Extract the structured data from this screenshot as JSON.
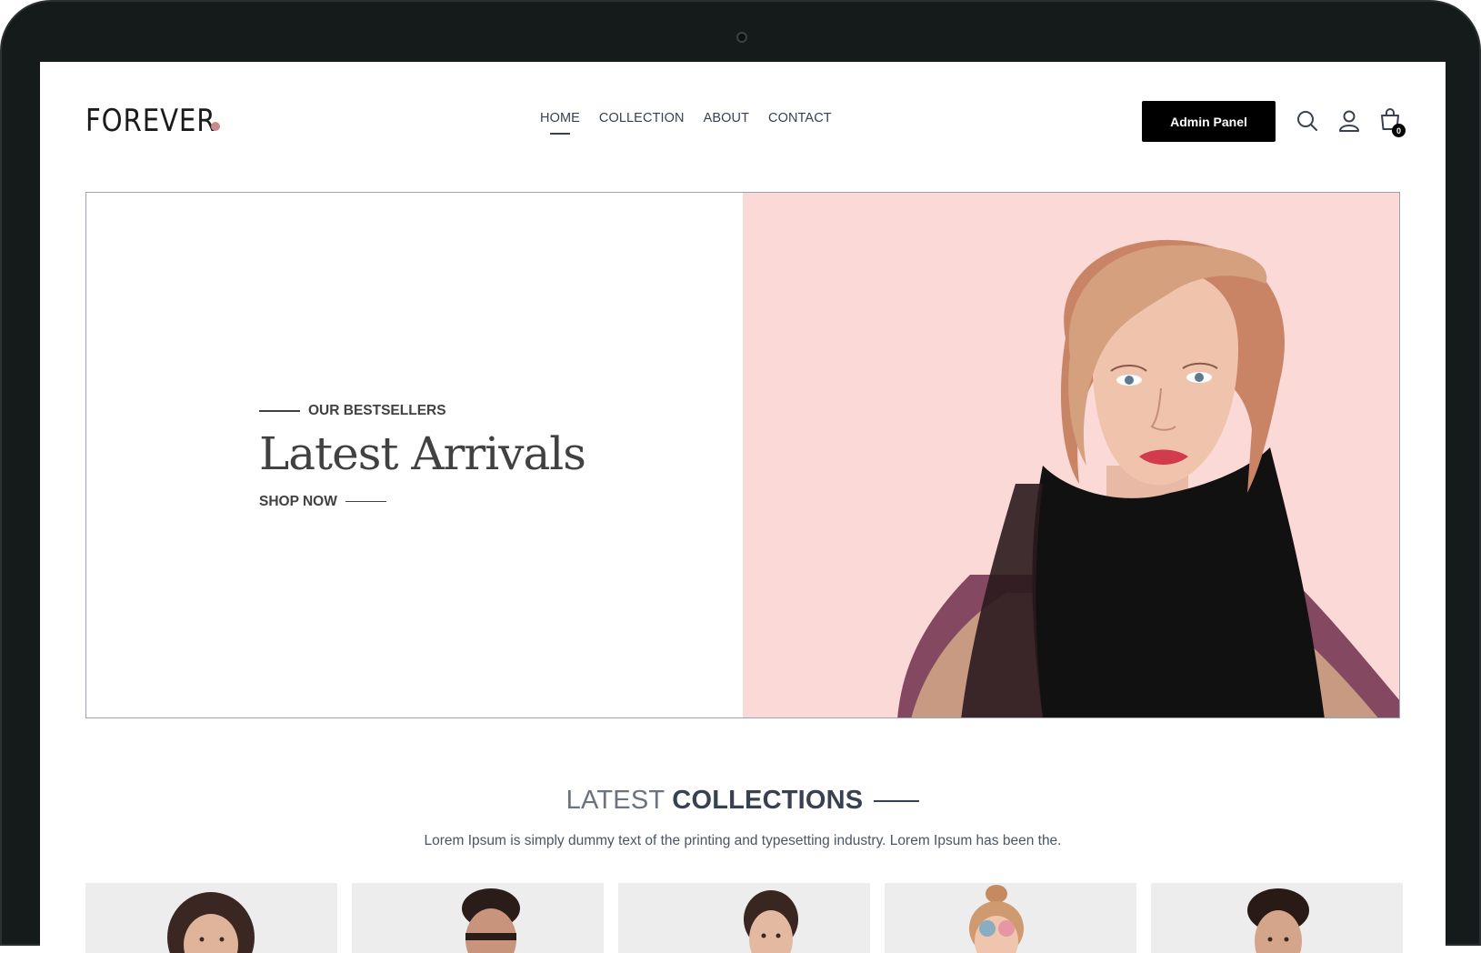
{
  "brand": {
    "name": "FOREVER",
    "dot_color": "#c58d8a"
  },
  "nav": {
    "items": [
      {
        "label": "HOME",
        "active": true
      },
      {
        "label": "COLLECTION",
        "active": false
      },
      {
        "label": "ABOUT",
        "active": false
      },
      {
        "label": "CONTACT",
        "active": false
      }
    ]
  },
  "header": {
    "admin_label": "Admin Panel",
    "cart_count": "0",
    "icons": [
      "search-icon",
      "profile-icon",
      "cart-icon"
    ]
  },
  "hero": {
    "kicker": "OUR BESTSELLERS",
    "title": "Latest Arrivals",
    "cta": "SHOP NOW",
    "bg_color": "#fad9d6"
  },
  "collections": {
    "title_light": "LATEST",
    "title_bold": "COLLECTIONS",
    "description": "Lorem Ipsum is simply dummy text of the printing and typesetting industry. Lorem Ipsum has been the.",
    "cards_count": 5
  },
  "colors": {
    "text": "#374151",
    "button": "#000000",
    "frame": "#151a1b"
  }
}
